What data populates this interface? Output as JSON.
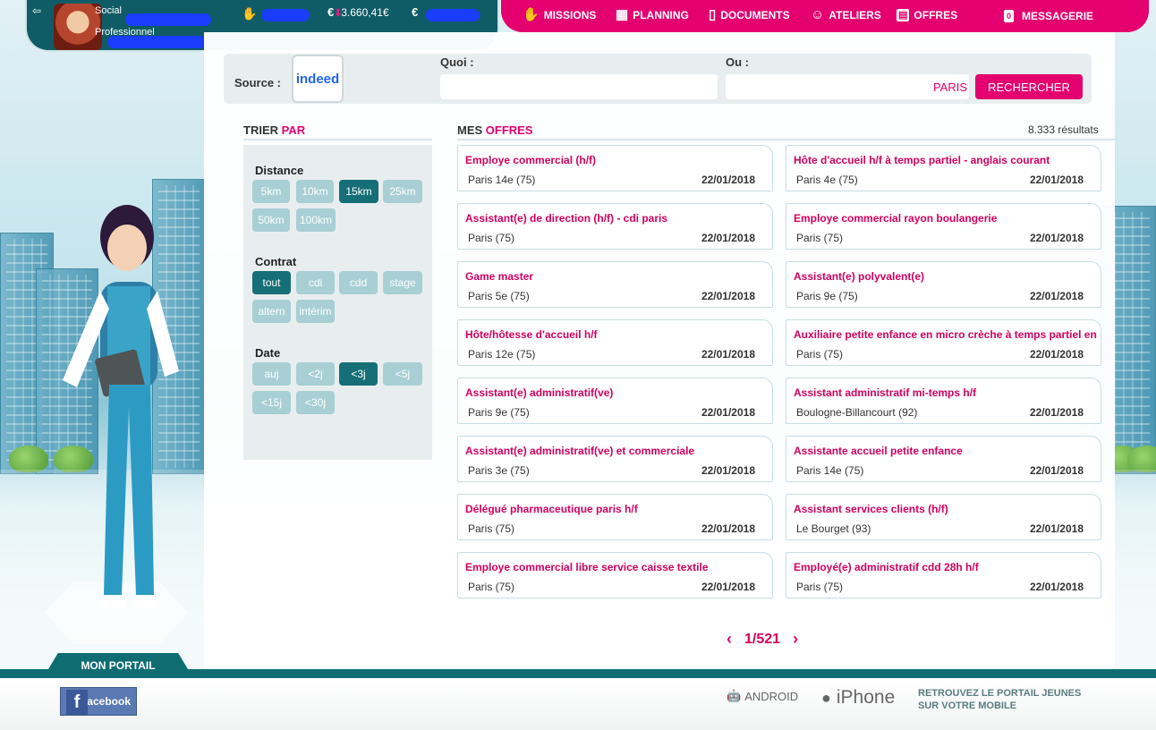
{
  "header": {
    "social_label": "Social",
    "professionnel_label": "Professionnel",
    "money_value": "3.660,41€",
    "euro_symbol": "€",
    "nav": [
      {
        "label": "MISSIONS",
        "icon": "hand-icon"
      },
      {
        "label": "PLANNING",
        "icon": "calendar-icon"
      },
      {
        "label": "DOCUMENTS",
        "icon": "document-icon"
      },
      {
        "label": "ATELIERS",
        "icon": "head-icon"
      },
      {
        "label": "OFFRES",
        "icon": "briefcase-icon"
      },
      {
        "label": "MESSAGERIE",
        "icon": "message-icon",
        "badge": "0"
      }
    ]
  },
  "search": {
    "source_label": "Source :",
    "source_name": "indeed",
    "quoi_label": "Quoi :",
    "ou_label": "Ou :",
    "location_value": "PARIS",
    "search_button": "RECHERCHER"
  },
  "sort": {
    "title_a": "TRIER ",
    "title_b": "PAR",
    "distance_title": "Distance",
    "distance_options": [
      "5km",
      "10km",
      "15km",
      "25km",
      "50km",
      "100km"
    ],
    "distance_selected": "15km",
    "contrat_title": "Contrat",
    "contrat_options": [
      "tout",
      "cdi",
      "cdd",
      "stage",
      "altern",
      "intérim"
    ],
    "contrat_selected": "tout",
    "date_title": "Date",
    "date_options": [
      "auj",
      "<2j",
      "<3j",
      "<5j",
      "<15j",
      "<30j"
    ],
    "date_selected": "<3j"
  },
  "offers": {
    "title_a": "MES ",
    "title_b": "OFFRES",
    "results_count": "8.333 résultats",
    "items": [
      {
        "title": "Employe commercial (h/f)",
        "location": "Paris 14e (75)",
        "date": "22/01/2018"
      },
      {
        "title": "Hôte d'accueil h/f à temps partiel - anglais courant",
        "location": "Paris 4e (75)",
        "date": "22/01/2018"
      },
      {
        "title": "Assistant(e) de direction (h/f) - cdi paris",
        "location": "Paris (75)",
        "date": "22/01/2018"
      },
      {
        "title": "Employe commercial rayon boulangerie",
        "location": "Paris (75)",
        "date": "22/01/2018"
      },
      {
        "title": "Game master",
        "location": "Paris 5e (75)",
        "date": "22/01/2018"
      },
      {
        "title": "Assistant(e) polyvalent(e)",
        "location": "Paris 9e (75)",
        "date": "22/01/2018"
      },
      {
        "title": "Hôte/hôtesse d'accueil h/f",
        "location": "Paris 12e (75)",
        "date": "22/01/2018"
      },
      {
        "title": "Auxiliaire petite enfance en micro crèche à temps partiel en",
        "location": "Paris (75)",
        "date": "22/01/2018"
      },
      {
        "title": "Assistant(e) administratif(ve)",
        "location": "Paris 9e (75)",
        "date": "22/01/2018"
      },
      {
        "title": "Assistant administratif mi-temps h/f",
        "location": "Boulogne-Billancourt (92)",
        "date": "22/01/2018"
      },
      {
        "title": "Assistant(e) administratif(ve) et commerciale",
        "location": "Paris 3e (75)",
        "date": "22/01/2018"
      },
      {
        "title": "Assistante accueil petite enfance",
        "location": "Paris 14e (75)",
        "date": "22/01/2018"
      },
      {
        "title": "Délégué pharmaceutique paris h/f",
        "location": "Paris (75)",
        "date": "22/01/2018"
      },
      {
        "title": "Assistant services clients (h/f)",
        "location": "Le Bourget (93)",
        "date": "22/01/2018"
      },
      {
        "title": "Employe commercial libre service caisse textile",
        "location": "Paris (75)",
        "date": "22/01/2018"
      },
      {
        "title": "Employé(e) administratif cdd 28h h/f",
        "location": "Paris (75)",
        "date": "22/01/2018"
      }
    ]
  },
  "pager": {
    "current": "1",
    "separator": "/",
    "total": "521"
  },
  "footer": {
    "portail_tab": "MON PORTAIL",
    "facebook_label": "facebook",
    "android_label": "ANDROID",
    "iphone_label": "iPhone",
    "mobile_line1": "RETROUVEZ LE PORTAIL JEUNES",
    "mobile_line2": "SUR VOTRE MOBILE"
  },
  "colors": {
    "accent": "#e4006f",
    "teal": "#0f5c66",
    "chip": "#a7cfd4",
    "chip_selected": "#166f76"
  }
}
